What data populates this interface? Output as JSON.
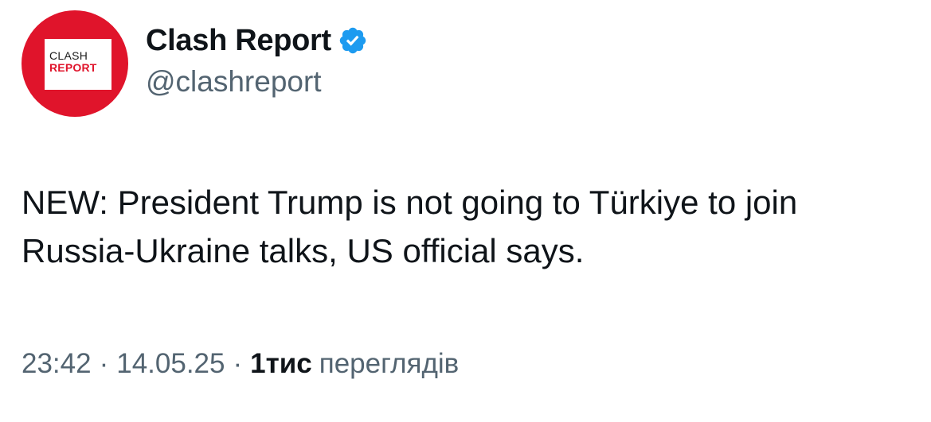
{
  "author": {
    "avatar_logo": {
      "line1": "CLASH",
      "line2": "REPORT"
    },
    "display_name": "Clash Report",
    "handle": "@clashreport",
    "verified_icon": "verified-badge-icon",
    "colors": {
      "avatar_bg": "#e0142b",
      "verified_badge": "#1d9bf0"
    }
  },
  "tweet": {
    "text": "NEW: President Trump is not going to Türkiye to join Russia-Ukraine talks, US official says."
  },
  "meta": {
    "time": "23:42",
    "separator": "·",
    "date": "14.05.25",
    "views_count": "1тис",
    "views_label": "переглядів"
  }
}
